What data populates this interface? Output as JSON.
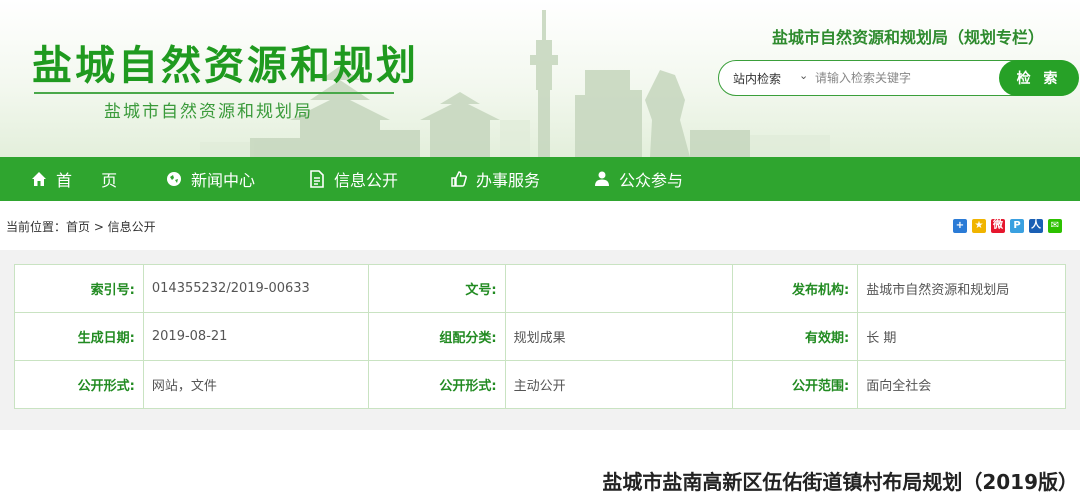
{
  "header": {
    "title": "盐城自然资源和规划",
    "subtitle": "盐城市自然资源和规划局",
    "topic_link": "盐城市自然资源和规划局（规划专栏）"
  },
  "search": {
    "scope": "站内检索",
    "placeholder": "请输入检索关键字",
    "button": "检 索"
  },
  "nav": {
    "items": [
      {
        "label": "首 页",
        "icon": "home-icon"
      },
      {
        "label": "新闻中心",
        "icon": "globe-icon"
      },
      {
        "label": "信息公开",
        "icon": "document-icon"
      },
      {
        "label": "办事服务",
        "icon": "thumbs-up-icon"
      },
      {
        "label": "公众参与",
        "icon": "user-icon"
      }
    ]
  },
  "breadcrumb": "当前位置：首页 > 信息公开",
  "share_icons": [
    "plus-share-icon",
    "qzone-share-icon",
    "weibo-share-icon",
    "pengyou-share-icon",
    "renren-share-icon",
    "wechat-share-icon"
  ],
  "info": {
    "rows": [
      [
        {
          "label": "索引号:",
          "value": "014355232/2019-00633"
        },
        {
          "label": "文号:",
          "value": ""
        },
        {
          "label": "发布机构:",
          "value": "盐城市自然资源和规划局"
        }
      ],
      [
        {
          "label": "生成日期:",
          "value": "2019-08-21"
        },
        {
          "label": "组配分类:",
          "value": "规划成果"
        },
        {
          "label": "有效期:",
          "value": "长 期"
        }
      ],
      [
        {
          "label": "公开形式:",
          "value": "网站，文件"
        },
        {
          "label": "公开形式:",
          "value": "主动公开"
        },
        {
          "label": "公开范围:",
          "value": "面向全社会"
        }
      ]
    ]
  },
  "article": {
    "title": "盐城市盐南高新区伍佑街道镇村布局规划（2019版）"
  },
  "colors": {
    "brand_green": "#2fa52f",
    "title_green": "#1f9a1f"
  }
}
